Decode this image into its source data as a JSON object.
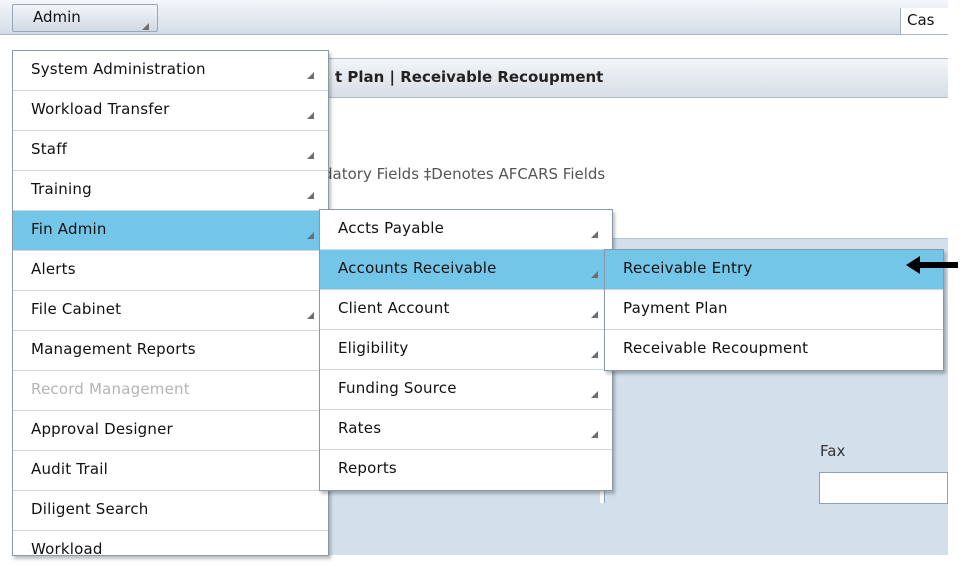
{
  "topbar": {
    "admin_label": "Admin",
    "case_label": "Cas"
  },
  "page": {
    "crumbs": "t Plan | Receivable Recoupment",
    "fields_note": "datory Fields  ‡Denotes AFCARS Fields",
    "fax_label": "Fax"
  },
  "admin_menu": [
    {
      "label": "System Administration",
      "submenu": true
    },
    {
      "label": "Workload Transfer",
      "submenu": true
    },
    {
      "label": "Staff",
      "submenu": true
    },
    {
      "label": "Training",
      "submenu": true
    },
    {
      "label": "Fin Admin",
      "submenu": true,
      "highlighted": true
    },
    {
      "label": "Alerts",
      "submenu": false
    },
    {
      "label": "File Cabinet",
      "submenu": true
    },
    {
      "label": "Management Reports",
      "submenu": false
    },
    {
      "label": "Record Management",
      "submenu": false,
      "disabled": true
    },
    {
      "label": "Approval Designer",
      "submenu": false
    },
    {
      "label": "Audit Trail",
      "submenu": false
    },
    {
      "label": "Diligent Search",
      "submenu": false
    },
    {
      "label": "Workload",
      "submenu": false
    }
  ],
  "fin_admin_menu": [
    {
      "label": "Accts Payable",
      "submenu": true
    },
    {
      "label": "Accounts Receivable",
      "submenu": true,
      "highlighted": true
    },
    {
      "label": "Client Account",
      "submenu": true
    },
    {
      "label": "Eligibility",
      "submenu": true
    },
    {
      "label": "Funding Source",
      "submenu": true
    },
    {
      "label": "Rates",
      "submenu": true
    },
    {
      "label": "Reports",
      "submenu": false
    }
  ],
  "ar_menu": [
    {
      "label": "Receivable Entry",
      "highlighted": true
    },
    {
      "label": "Payment Plan"
    },
    {
      "label": "Receivable Recoupment"
    }
  ],
  "colors": {
    "highlight": "#73c6e8",
    "panel": "#d3dfeb"
  },
  "icons": {
    "submenu": "submenu-arrow-icon",
    "pointer": "left-arrow-icon"
  }
}
